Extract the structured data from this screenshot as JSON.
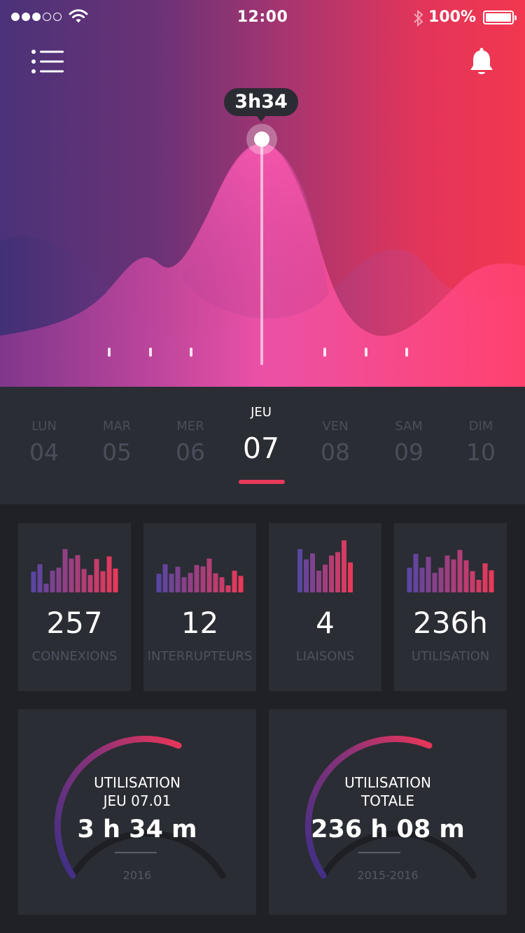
{
  "status_bar": {
    "time": "12:00",
    "battery": "100%",
    "signal_bars_filled": 3,
    "signal_bars_total": 5
  },
  "header": {
    "menu_icon": "menu-list-icon",
    "bell_icon": "bell-icon"
  },
  "hero_chart": {
    "tooltip": "3h34"
  },
  "days": [
    {
      "name": "LUN",
      "num": "04",
      "active": false
    },
    {
      "name": "MAR",
      "num": "05",
      "active": false
    },
    {
      "name": "MER",
      "num": "06",
      "active": false
    },
    {
      "name": "JEU",
      "num": "07",
      "active": true
    },
    {
      "name": "VEN",
      "num": "08",
      "active": false
    },
    {
      "name": "SAM",
      "num": "09",
      "active": false
    },
    {
      "name": "DIM",
      "num": "10",
      "active": false
    }
  ],
  "stats": [
    {
      "value": "257",
      "label": "CONNEXIONS",
      "bars": [
        0.48,
        0.65,
        0.2,
        0.5,
        0.57,
        1.0,
        0.78,
        0.86,
        0.54,
        0.4,
        0.77,
        0.49,
        0.83,
        0.55
      ]
    },
    {
      "value": "12",
      "label": "INTERRUPTEURS",
      "bars": [
        0.43,
        0.65,
        0.43,
        0.59,
        0.35,
        0.45,
        0.63,
        0.6,
        0.78,
        0.44,
        0.35,
        0.16,
        0.5,
        0.38
      ]
    },
    {
      "value": "4",
      "label": "LIAISONS",
      "bars": [
        1.0,
        0.76,
        0.9,
        0.5,
        0.64,
        0.85,
        0.93,
        1.2,
        0.69
      ]
    },
    {
      "value": "236h",
      "label": "UTILISATION",
      "bars": [
        0.57,
        0.89,
        0.57,
        0.82,
        0.45,
        0.57,
        0.85,
        0.76,
        0.98,
        0.74,
        0.49,
        0.29,
        0.67,
        0.51
      ]
    }
  ],
  "gauges": [
    {
      "title1": "UTILISATION",
      "title2": "JEU 07.01",
      "value": "3 h 34 m",
      "sub": "2016"
    },
    {
      "title1": "UTILISATION",
      "title2": "TOTALE",
      "value": "236 h 08 m",
      "sub": "2015-2016"
    }
  ],
  "colors": {
    "accent": "#e8395a",
    "purple": "#5a45a0",
    "card_bg": "#2a2d34",
    "page_bg": "#1f2127"
  }
}
